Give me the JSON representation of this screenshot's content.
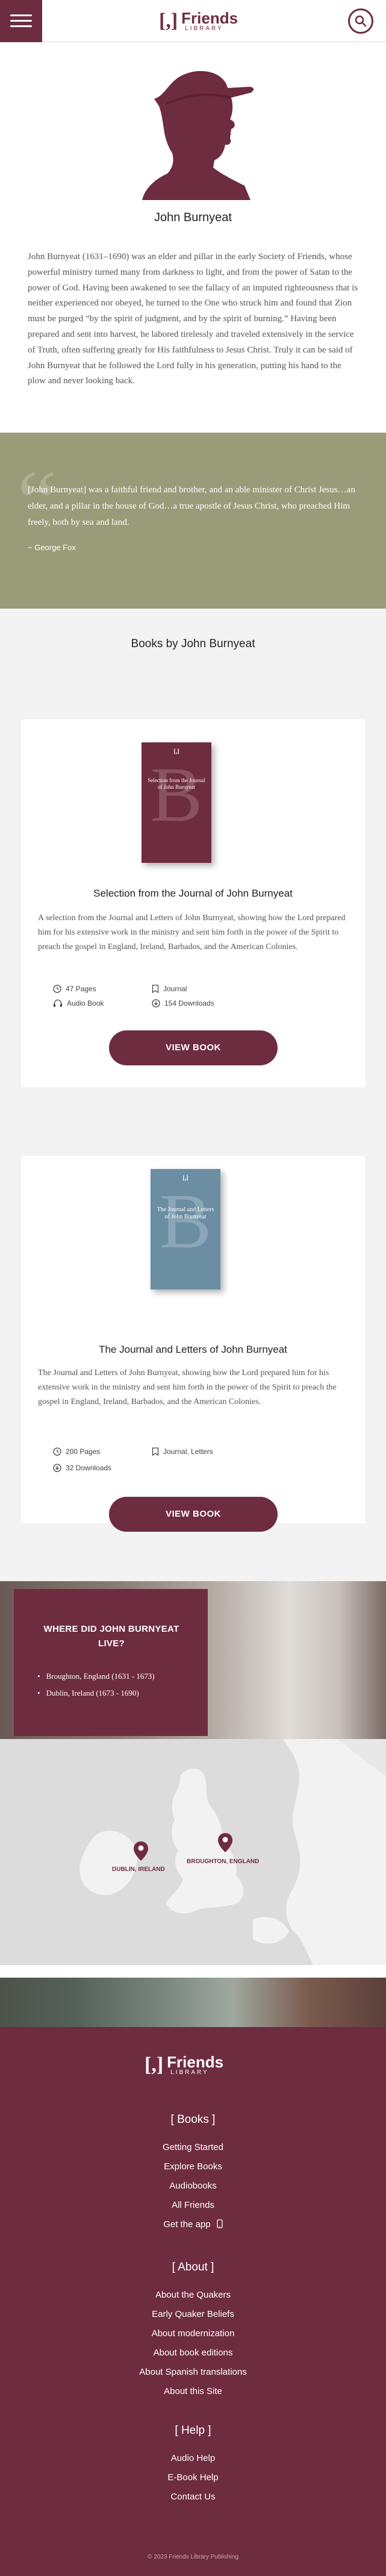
{
  "header": {
    "logo_mark": "[",
    "logo_mark_close": "]",
    "logo_text": "Friends",
    "logo_sub": "LIBRARY",
    "menu_icon": "hamburger-icon",
    "search_icon": "search-icon"
  },
  "author": {
    "name": "John Burnyeat",
    "bio": "John Burnyeat (1631–1690) was an elder and pillar in the early Society of Friends, whose powerful ministry turned many from darkness to light, and from the power of Satan to the power of God. Having been awakened to see the fallacy of an imputed righteousness that is neither experienced nor obeyed, he turned to the One who struck him and found that Zion must be purged “by the spirit of judgment, and by the spirit of burning.” Having been prepared and sent into harvest, he labored tirelessly and traveled extensively in the service of Truth, often suffering greatly for His faithfulness to Jesus Christ. Truly it can be said of John Burnyeat that he followed the Lord fully in his generation, putting his hand to the plow and never looking back."
  },
  "quote": {
    "text": "[John Burnyeat] was a faithful friend and brother, and an able minister of Christ Jesus…an elder, and a pillar in the house of God…a true apostle of Jesus Christ, who preached Him freely, both by sea and land.",
    "cite": "~ George Fox"
  },
  "books": {
    "heading": "Books by John Burnyeat",
    "items": [
      {
        "cover_logo": "[,]",
        "cover_title": "Selection from the Journal of John Burnyeat",
        "cover_letter": "B",
        "title": "Selection from the Journal of John Burnyeat",
        "description": "A selection from the Journal and Letters of John Burnyeat, showing how the Lord prepared him for his extensive work in the ministry and sent him forth in the power of the Spirit to preach the gospel in England, Ireland, Barbados, and the American Colonies.",
        "pages": "47 Pages",
        "type": "Journal",
        "audio": "Audio Book",
        "downloads": "154 Downloads",
        "button": "VIEW BOOK"
      },
      {
        "cover_logo": "[,]",
        "cover_title": "The Journal and Letters of John Burnyeat",
        "cover_letter": "B",
        "title": "The Journal and Letters of John Burnyeat",
        "description": "The Journal and Letters of John Burnyeat, showing how the Lord prepared him for his extensive work in the ministry and sent him forth in the power of the Spirit to preach the gospel in England, Ireland, Barbados, and the American Colonies.",
        "pages": "200 Pages",
        "type": "Journal, Letters",
        "downloads": "32 Downloads",
        "button": "VIEW BOOK"
      }
    ]
  },
  "where": {
    "title": "WHERE DID JOHN BURNYEAT LIVE?",
    "places": [
      "Broughton, England (1631 - 1673)",
      "Dublin, Ireland (1673 - 1690)"
    ]
  },
  "map": {
    "pins": [
      "DUBLIN, IRELAND",
      "BROUGHTON, ENGLAND"
    ]
  },
  "footer": {
    "logo_mark": "[",
    "logo_mark_close": "]",
    "logo_text": "Friends",
    "logo_sub": "LIBRARY",
    "books_heading": "[ Books ]",
    "books_links": [
      "Getting Started",
      "Explore Books",
      "Audiobooks",
      "All Friends",
      "Get the app"
    ],
    "about_heading": "[ About ]",
    "about_links": [
      "About the Quakers",
      "Early Quaker Beliefs",
      "About modernization",
      "About book editions",
      "About Spanish translations",
      "About this Site"
    ],
    "help_heading": "[ Help ]",
    "help_links": [
      "Audio Help",
      "E-Book Help",
      "Contact Us"
    ],
    "copyright": "© 2023 Friends Library Publishing"
  },
  "colors": {
    "brand": "#6e2c40",
    "quote_bg": "#9a9c79",
    "section_bg": "#f3f3f3"
  }
}
